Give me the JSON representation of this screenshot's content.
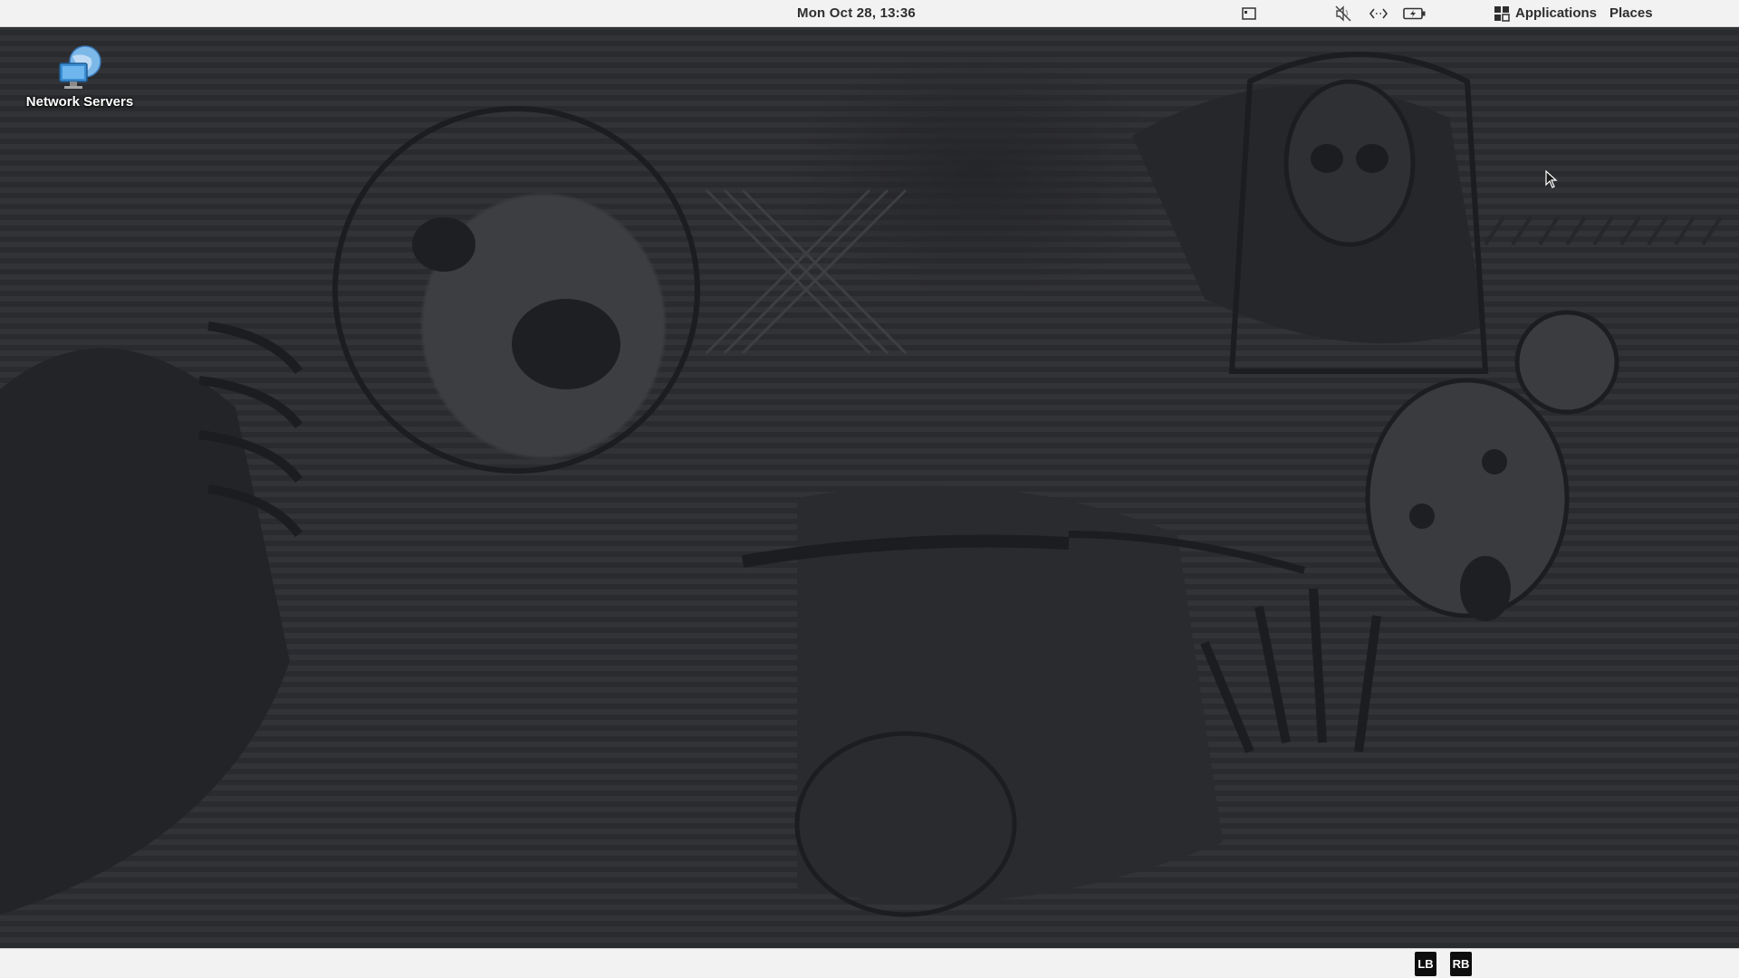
{
  "top_panel": {
    "clock": "Mon Oct 28, 13:36",
    "tray_icons": [
      "window-list-icon",
      "volume-muted-icon",
      "network-icon",
      "battery-charging-icon"
    ],
    "applications_label": "Applications",
    "places_label": "Places"
  },
  "desktop": {
    "icons": [
      {
        "label": "Network Servers",
        "icon": "network-servers-icon"
      }
    ]
  },
  "bottom_panel": {
    "left_button_label": "LB",
    "right_button_label": "RB"
  },
  "colors": {
    "panel_bg": "#f2f2f2",
    "panel_text": "#2e2e2e",
    "wallpaper_base": "#2e2f33",
    "indicator_bg": "#0d0d0d"
  }
}
